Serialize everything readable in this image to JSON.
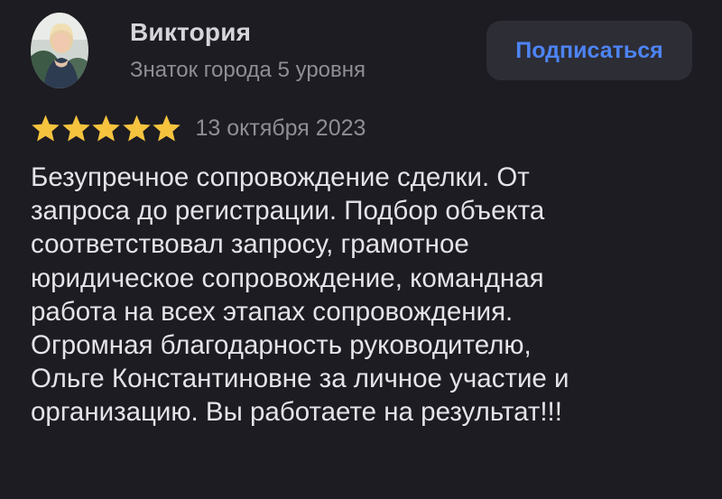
{
  "author": {
    "name": "Виктория",
    "status": "Знаток города 5 уровня",
    "avatar_icon": "user-photo-avatar"
  },
  "subscribe_button": {
    "label": "Подписаться"
  },
  "review": {
    "rating": 5,
    "rating_max": 5,
    "star_color": "#f6c33e",
    "date": "13 октября 2023",
    "text_lines": [
      "Безупречное сопровождение сделки. От",
      "запроса до регистрации. Подбор объекта",
      "соответствовал запросу, грамотное",
      "юридическое сопровождение, командная",
      "работа на всех этапах сопровождения.",
      "Огромная благодарность руководителю,",
      "Ольге Константиновне за личное участие и",
      "организацию. Вы работаете на результат!!!"
    ]
  },
  "colors": {
    "background": "#1d1c22",
    "button_background": "#2d2d36",
    "accent": "#4d84f5"
  }
}
